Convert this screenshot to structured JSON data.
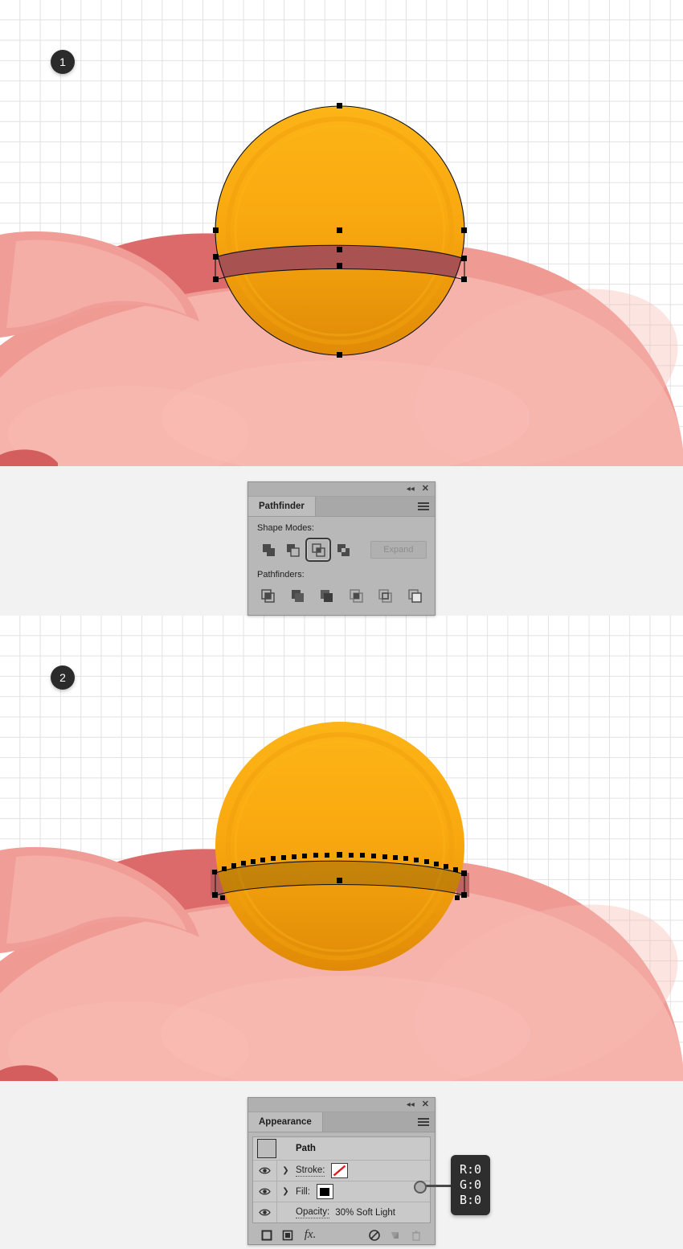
{
  "steps": [
    {
      "number": "1"
    },
    {
      "number": "2"
    }
  ],
  "colors": {
    "coin_light": "#fbb016",
    "coin_mid": "#f7a50c",
    "coin_dark": "#e08a07",
    "band_dark_red": "#a85252",
    "pig_light": "#f6b3ab",
    "pig_mid": "#f09a93",
    "pig_dark": "#dd6a6a",
    "pig_darker": "#d45e5e",
    "badge_bg": "#2b2b2b",
    "panel_bg": "#b8b8b8",
    "callout_bg": "#2e2e2e",
    "grid_line": "#e2e2e2",
    "page_bg": "#f2f2f2"
  },
  "pathfinder_panel": {
    "tab_label": "Pathfinder",
    "collapse_icon": "double-chevron-left-icon",
    "close_icon": "close-icon",
    "menu_icon": "panel-menu-icon",
    "shape_modes_label": "Shape Modes:",
    "pathfinders_label": "Pathfinders:",
    "expand_label": "Expand",
    "expand_enabled": false,
    "shape_modes": [
      {
        "name": "unite",
        "selected": false
      },
      {
        "name": "minus-front",
        "selected": false
      },
      {
        "name": "intersect",
        "selected": true
      },
      {
        "name": "exclude",
        "selected": false
      }
    ],
    "pathfinders": [
      {
        "name": "divide"
      },
      {
        "name": "trim"
      },
      {
        "name": "merge"
      },
      {
        "name": "crop"
      },
      {
        "name": "outline"
      },
      {
        "name": "minus-back"
      }
    ]
  },
  "appearance_panel": {
    "tab_label": "Appearance",
    "collapse_icon": "double-chevron-left-icon",
    "close_icon": "close-icon",
    "menu_icon": "panel-menu-icon",
    "object_type": "Path",
    "rows": [
      {
        "label": "Stroke:",
        "swatch": "none",
        "visible": true,
        "expandable": true
      },
      {
        "label": "Fill:",
        "swatch": "black",
        "visible": true,
        "expandable": true
      }
    ],
    "opacity_label": "Opacity:",
    "opacity_value": "30% Soft Light",
    "footer_icons": [
      "add-new-stroke-icon",
      "add-new-fill-icon",
      "add-new-effect-icon",
      "clear-appearance-icon",
      "duplicate-item-icon",
      "delete-item-icon"
    ]
  },
  "rgb_callout": {
    "r": "R:0",
    "g": "G:0",
    "b": "B:0"
  }
}
